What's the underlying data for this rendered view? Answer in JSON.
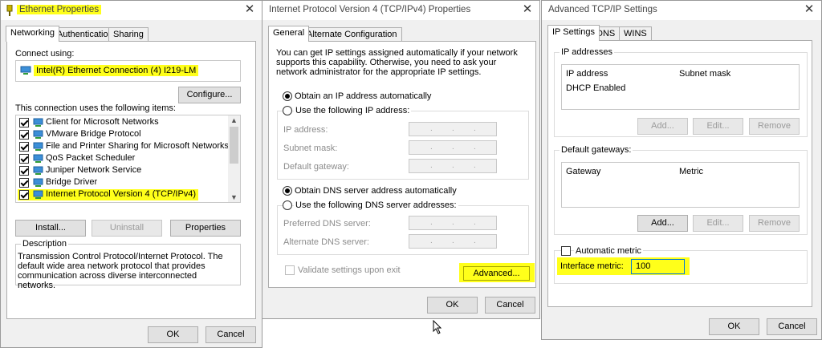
{
  "eth": {
    "title": "Ethernet Properties",
    "tabs": [
      "Networking",
      "Authentication",
      "Sharing"
    ],
    "connect_using_label": "Connect using:",
    "adapter": "Intel(R) Ethernet Connection (4) I219-LM",
    "configure": "Configure...",
    "items_label": "This connection uses the following items:",
    "items": [
      {
        "label": "Client for Microsoft Networks",
        "checked": true
      },
      {
        "label": "VMware Bridge Protocol",
        "checked": true
      },
      {
        "label": "File and Printer Sharing for Microsoft Networks",
        "checked": true
      },
      {
        "label": "QoS Packet Scheduler",
        "checked": true
      },
      {
        "label": "Juniper Network Service",
        "checked": true
      },
      {
        "label": "Bridge Driver",
        "checked": true
      },
      {
        "label": "Internet Protocol Version 4 (TCP/IPv4)",
        "checked": true
      }
    ],
    "install": "Install...",
    "uninstall": "Uninstall",
    "properties": "Properties",
    "description_label": "Description",
    "description": "Transmission Control Protocol/Internet Protocol. The default wide area network protocol that provides communication across diverse interconnected networks.",
    "ok": "OK",
    "cancel": "Cancel"
  },
  "ipv4": {
    "title": "Internet Protocol Version 4 (TCP/IPv4) Properties",
    "tabs": [
      "General",
      "Alternate Configuration"
    ],
    "intro": "You can get IP settings assigned automatically if your network supports this capability. Otherwise, you need to ask your network administrator for the appropriate IP settings.",
    "obtain_ip": "Obtain an IP address automatically",
    "use_ip": "Use the following IP address:",
    "ip_address": "IP address:",
    "subnet_mask": "Subnet mask:",
    "default_gateway": "Default gateway:",
    "obtain_dns": "Obtain DNS server address automatically",
    "use_dns": "Use the following DNS server addresses:",
    "preferred_dns": "Preferred DNS server:",
    "alternate_dns": "Alternate DNS server:",
    "validate": "Validate settings upon exit",
    "advanced": "Advanced...",
    "ok": "OK",
    "cancel": "Cancel"
  },
  "adv": {
    "title": "Advanced TCP/IP Settings",
    "tabs": [
      "IP Settings",
      "DNS",
      "WINS"
    ],
    "ip_addresses_label": "IP addresses",
    "col_ip": "IP address",
    "col_subnet": "Subnet mask",
    "dhcp": "DHCP Enabled",
    "add1": "Add...",
    "edit1": "Edit...",
    "remove1": "Remove",
    "gateways_label": "Default gateways:",
    "col_gateway": "Gateway",
    "col_metric": "Metric",
    "add2": "Add...",
    "edit2": "Edit...",
    "remove2": "Remove",
    "automatic_metric": "Automatic metric",
    "interface_metric": "Interface metric:",
    "metric_value": "100",
    "ok": "OK",
    "cancel": "Cancel"
  },
  "colors": {
    "highlight": "#ffff1a",
    "window_bg": "#f0f0f0",
    "focus_border": "#0078d7"
  }
}
